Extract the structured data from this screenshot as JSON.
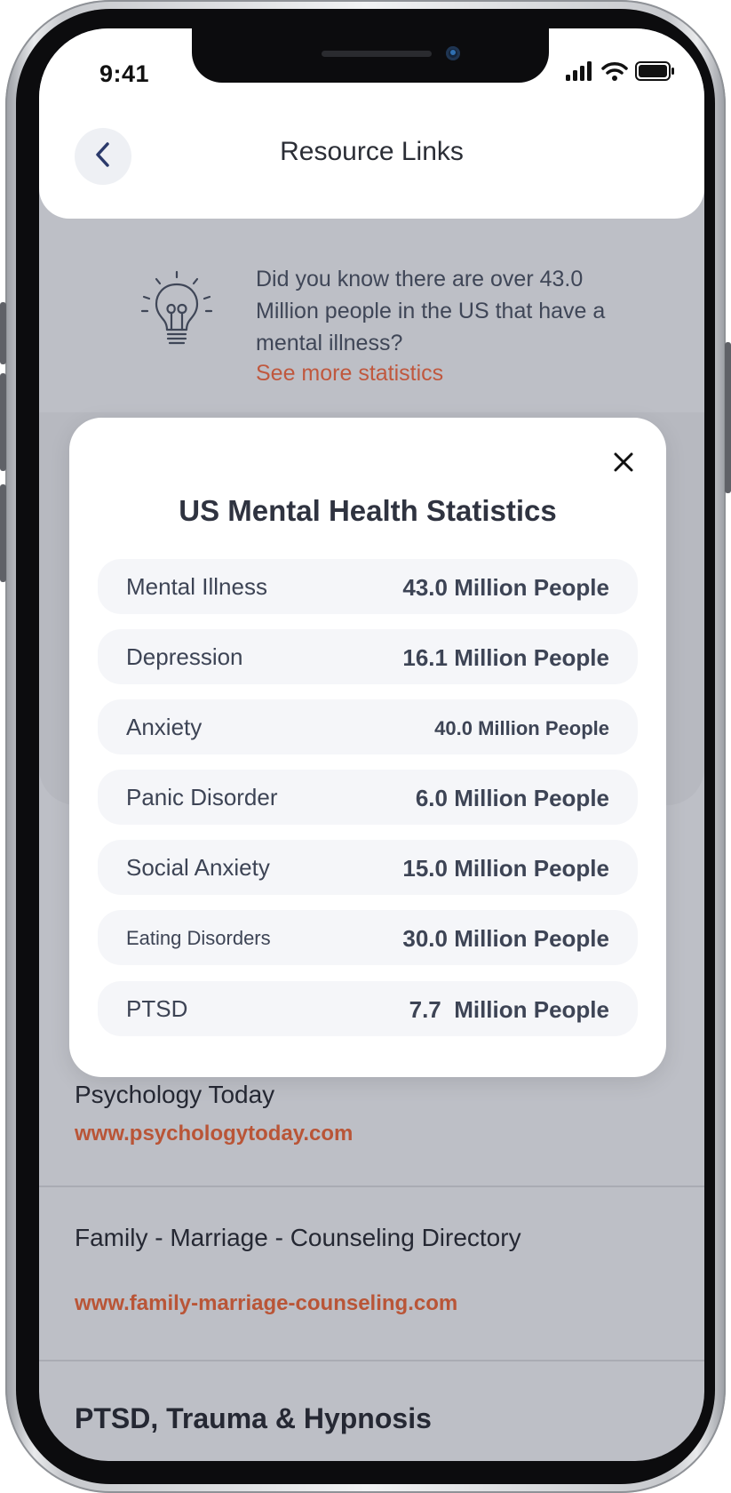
{
  "status_bar": {
    "time": "9:41"
  },
  "header": {
    "title": "Resource Links"
  },
  "tip": {
    "text": "Did you know there are over 43.0 Million people in the US that have a mental illness?",
    "link": "See more statistics"
  },
  "modal": {
    "title": "US Mental Health Statistics",
    "rows": [
      {
        "label": "Mental Illness",
        "value": "43.0 Million People"
      },
      {
        "label": "Depression",
        "value": "16.1 Million People"
      },
      {
        "label": "Anxiety",
        "value": "40.0 Million People"
      },
      {
        "label": "Panic Disorder",
        "value": "6.0 Million People"
      },
      {
        "label": "Social Anxiety",
        "value": "15.0 Million People"
      },
      {
        "label": "Eating Disorders",
        "value": "30.0 Million People"
      },
      {
        "label": "PTSD",
        "value": "7.7  Million People"
      }
    ]
  },
  "resources": [
    {
      "name": "Psychology Today",
      "url": "www.psychologytoday.com"
    },
    {
      "name": "Family - Marriage - Counseling Directory",
      "url": "www.family-marriage-counseling.com"
    },
    {
      "name": "PTSD, Trauma & Hypnosis"
    }
  ],
  "colors": {
    "accent": "#c0583e",
    "overlay_bg": "#bdbfc6",
    "text_dark": "#2f3340"
  },
  "icons": [
    "back-chevron-icon",
    "lightbulb-icon",
    "close-icon",
    "signal-icon",
    "wifi-icon",
    "battery-icon"
  ]
}
